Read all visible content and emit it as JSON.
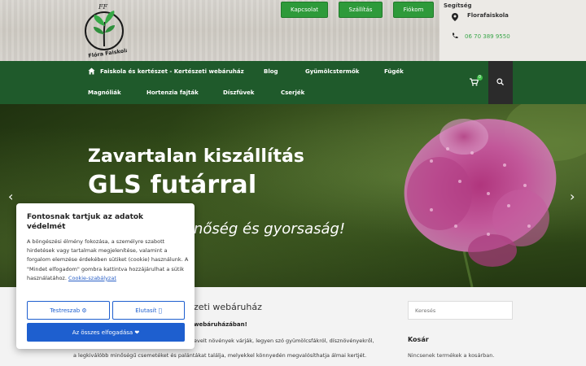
{
  "header": {
    "logo_text": "Flóra Faiskola",
    "logo_initials": "FF",
    "buttons": [
      "Kapcsolat",
      "Szállítás",
      "Fiókom"
    ],
    "help_label": "Segítség",
    "shop_name": "Florafaiskola",
    "phone": "06 70 389 9550"
  },
  "nav": {
    "items": [
      "Faiskola és kertészet - Kertészeti webáruház",
      "Blog",
      "Gyümölcstermők",
      "Fügék",
      "Magnóliák",
      "Hortenzia fajták",
      "Díszfüvek",
      "Cserjék"
    ],
    "cart_count": "0"
  },
  "hero": {
    "line1": "Zavartalan kiszállítás",
    "line2": "GLS futárral",
    "line3": "nőség és gyorsaság!",
    "prev_arrow": "‹",
    "next_arrow": "›"
  },
  "content": {
    "title": "zeti webáruház",
    "bold_line": "webáruházában!",
    "line1": "evelt növények várják, legyen szó gyümölcsfákról, dísznövényekről,",
    "line2": "a legkiválóbb minőségű csemetéket és palántákat találja, melyekkel könnyedén megvalósíthatja álmai kertjét."
  },
  "sidebar": {
    "search_placeholder": "Keresés",
    "cart_title": "Kosár",
    "cart_empty": "Nincsenek termékek a kosárban."
  },
  "cookie": {
    "title": "Fontosnak tartjuk az adatok védelmét",
    "text": "A böngészési élmény fokozása, a személyre szabott hirdetések vagy tartalmak megjelenítése, valamint a forgalom elemzése érdekében sütiket (cookie) használunk. A \"Mindet elfogadom\" gombra kattintva hozzájárulhat a sütik használatához.",
    "link": "Cookie-szabályzat",
    "customize": "Testreszab ⚙",
    "reject": "Elutasít ⃠",
    "accept": "Az összes elfogadása ❤"
  }
}
